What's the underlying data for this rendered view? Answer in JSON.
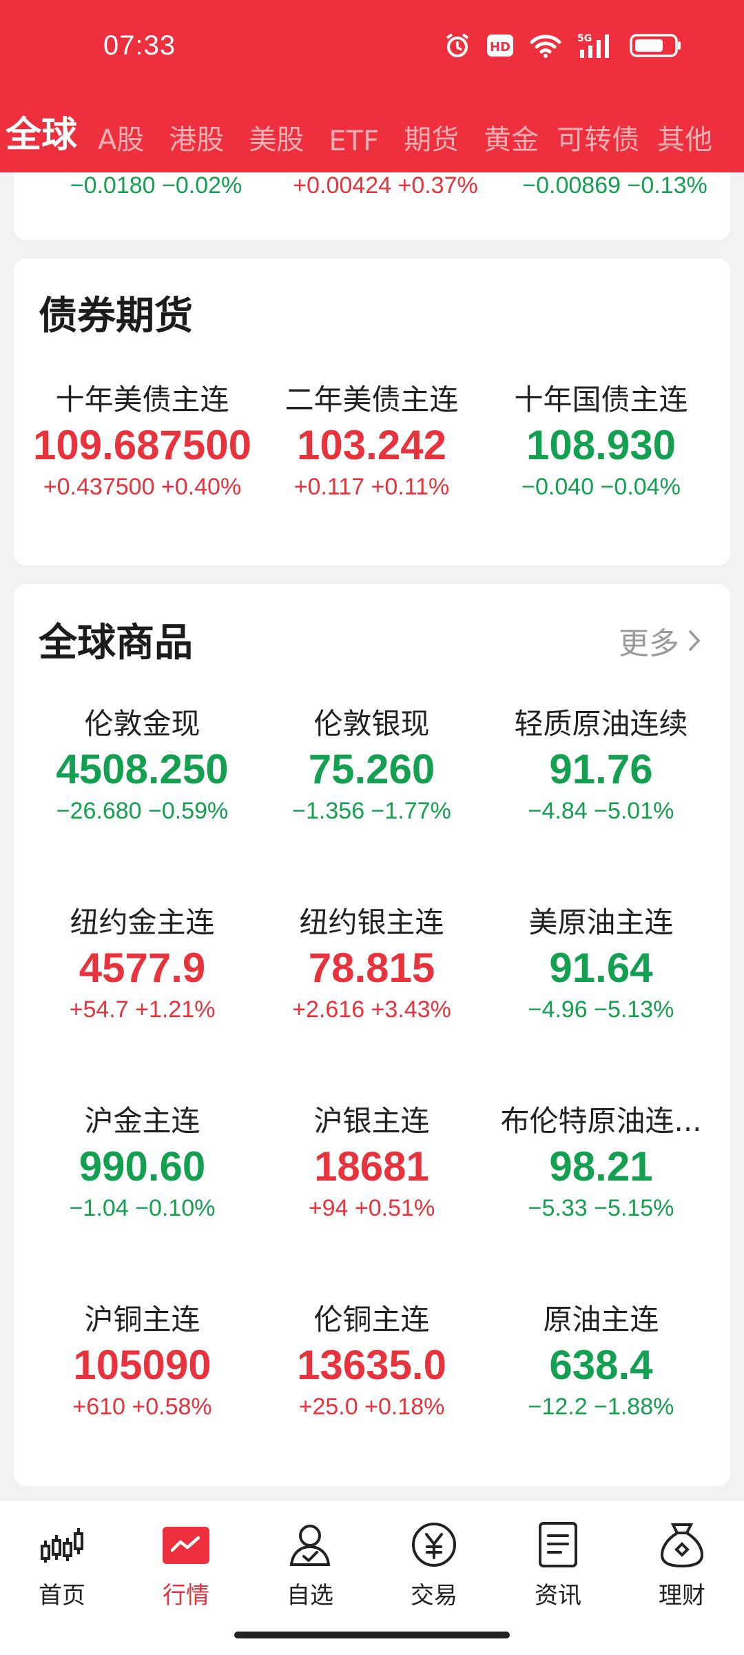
{
  "status": {
    "time": "07:33",
    "network": "5G",
    "hd": "HD"
  },
  "tabs": [
    {
      "label": "全球",
      "active": true
    },
    {
      "label": "A股"
    },
    {
      "label": "港股"
    },
    {
      "label": "美股"
    },
    {
      "label": "ETF"
    },
    {
      "label": "期货"
    },
    {
      "label": "黄金"
    },
    {
      "label": "可转债"
    },
    {
      "label": "其他"
    }
  ],
  "fx_partial": [
    {
      "change": "−0.0180 −0.02%",
      "dir": "down"
    },
    {
      "change": "+0.00424 +0.37%",
      "dir": "up"
    },
    {
      "change": "−0.00869 −0.13%",
      "dir": "down"
    }
  ],
  "bond_futures": {
    "title": "债券期货",
    "items": [
      {
        "name": "十年美债主连",
        "price": "109.687500",
        "change": "+0.437500 +0.40%",
        "dir": "up"
      },
      {
        "name": "二年美债主连",
        "price": "103.242",
        "change": "+0.117 +0.11%",
        "dir": "up"
      },
      {
        "name": "十年国债主连",
        "price": "108.930",
        "change": "−0.040 −0.04%",
        "dir": "down"
      }
    ]
  },
  "commodities": {
    "title": "全球商品",
    "more": "更多",
    "items": [
      {
        "name": "伦敦金现",
        "price": "4508.250",
        "change": "−26.680 −0.59%",
        "dir": "down"
      },
      {
        "name": "伦敦银现",
        "price": "75.260",
        "change": "−1.356 −1.77%",
        "dir": "down"
      },
      {
        "name": "轻质原油连续",
        "price": "91.76",
        "change": "−4.84 −5.01%",
        "dir": "down"
      },
      {
        "name": "纽约金主连",
        "price": "4577.9",
        "change": "+54.7 +1.21%",
        "dir": "up"
      },
      {
        "name": "纽约银主连",
        "price": "78.815",
        "change": "+2.616 +3.43%",
        "dir": "up"
      },
      {
        "name": "美原油主连",
        "price": "91.64",
        "change": "−4.96 −5.13%",
        "dir": "down"
      },
      {
        "name": "沪金主连",
        "price": "990.60",
        "change": "−1.04 −0.10%",
        "dir": "down"
      },
      {
        "name": "沪银主连",
        "price": "18681",
        "change": "+94 +0.51%",
        "dir": "up"
      },
      {
        "name": "布伦特原油连...",
        "price": "98.21",
        "change": "−5.33 −5.15%",
        "dir": "down"
      },
      {
        "name": "沪铜主连",
        "price": "105090",
        "change": "+610 +0.58%",
        "dir": "up"
      },
      {
        "name": "伦铜主连",
        "price": "13635.0",
        "change": "+25.0 +0.18%",
        "dir": "up"
      },
      {
        "name": "原油主连",
        "price": "638.4",
        "change": "−12.2 −1.88%",
        "dir": "down"
      }
    ]
  },
  "nav": [
    {
      "label": "首页",
      "icon": "candlestick-icon"
    },
    {
      "label": "行情",
      "icon": "market-chart-icon",
      "active": true
    },
    {
      "label": "自选",
      "icon": "user-check-icon"
    },
    {
      "label": "交易",
      "icon": "yen-coin-icon"
    },
    {
      "label": "资讯",
      "icon": "document-icon"
    },
    {
      "label": "理财",
      "icon": "money-bag-icon"
    }
  ],
  "colors": {
    "brand": "#ee2f3d",
    "up": "#e8323c",
    "down": "#13a050"
  }
}
